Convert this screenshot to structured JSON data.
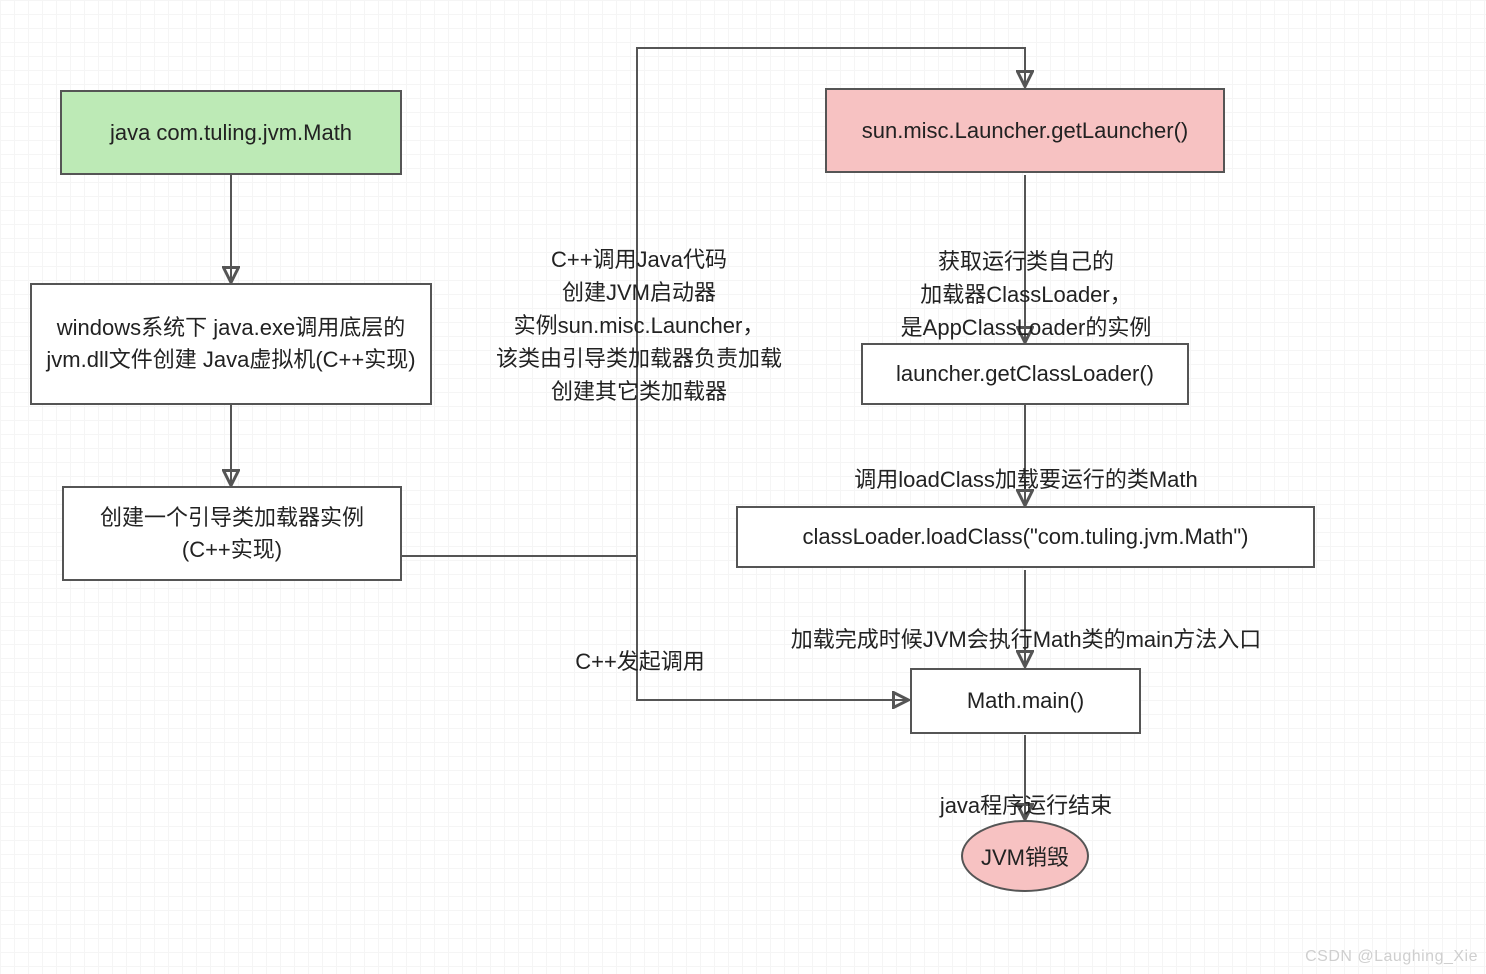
{
  "boxes": {
    "start": "java com.tuling.jvm.Math",
    "jvm_create": "windows系统下\njava.exe调用底层的jvm.dll文件创建\nJava虚拟机(C++实现)",
    "boot_loader": "创建一个引导类加载器实例\n(C++实现)",
    "launcher": "sun.misc.Launcher.getLauncher()",
    "get_loader": "launcher.getClassLoader()",
    "load_class": "classLoader.loadClass(\"com.tuling.jvm.Math\")",
    "main": "Math.main()",
    "destroy": "JVM销毁"
  },
  "edges": {
    "cpp_call_java": "C++调用Java代码\n创建JVM启动器\n实例sun.misc.Launcher，\n该类由引导类加载器负责加载\n创建其它类加载器",
    "cpp_invoke": "C++发起调用",
    "get_runtime_loader": "获取运行类自己的\n加载器ClassLoader，\n是AppClassLoader的实例",
    "load_math": "调用loadClass加载要运行的类Math",
    "exec_main": "加载完成时候JVM会执行Math类的main方法入口",
    "program_end": "java程序运行结束"
  },
  "watermark": "CSDN @Laughing_Xie"
}
